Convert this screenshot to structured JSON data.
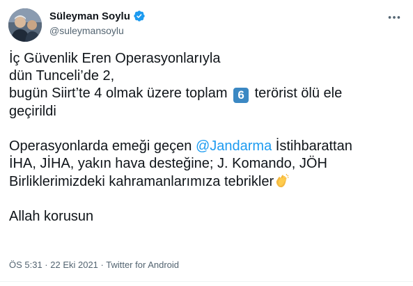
{
  "author": {
    "name": "Süleyman Soylu",
    "handle": "@suleymansoylu",
    "verified": true
  },
  "tweet": {
    "line1": "İç Güvenlik Eren Operasyonlarıyla",
    "line2": "dün Tunceli’de 2,",
    "line3_before": "bugün Siirt’te 4 olmak üzere toplam",
    "keycap": "6",
    "line3_after": "terörist ölü ele",
    "line4": "geçirildi",
    "line5_before": "Operasyonlarda emeği geçen",
    "mention": "@Jandarma",
    "line5_after": "İstihbarattan",
    "line6": "İHA, JİHA, yakın hava desteğine; J. Komando, JÖH",
    "line7": "Birliklerimizdeki kahramanlarımıza tebrikler",
    "line8": "Allah korusun"
  },
  "meta": {
    "text": "ÖS 5:31 · 22 Eki 2021 · Twitter for Android"
  },
  "icons": {
    "verified": "verified-badge-icon",
    "more": "more-options-icon",
    "clap": "clapping-hands-icon"
  },
  "colors": {
    "accent": "#1d9bf0",
    "keycap": "#3b88c3",
    "secondary_text": "#536471"
  }
}
